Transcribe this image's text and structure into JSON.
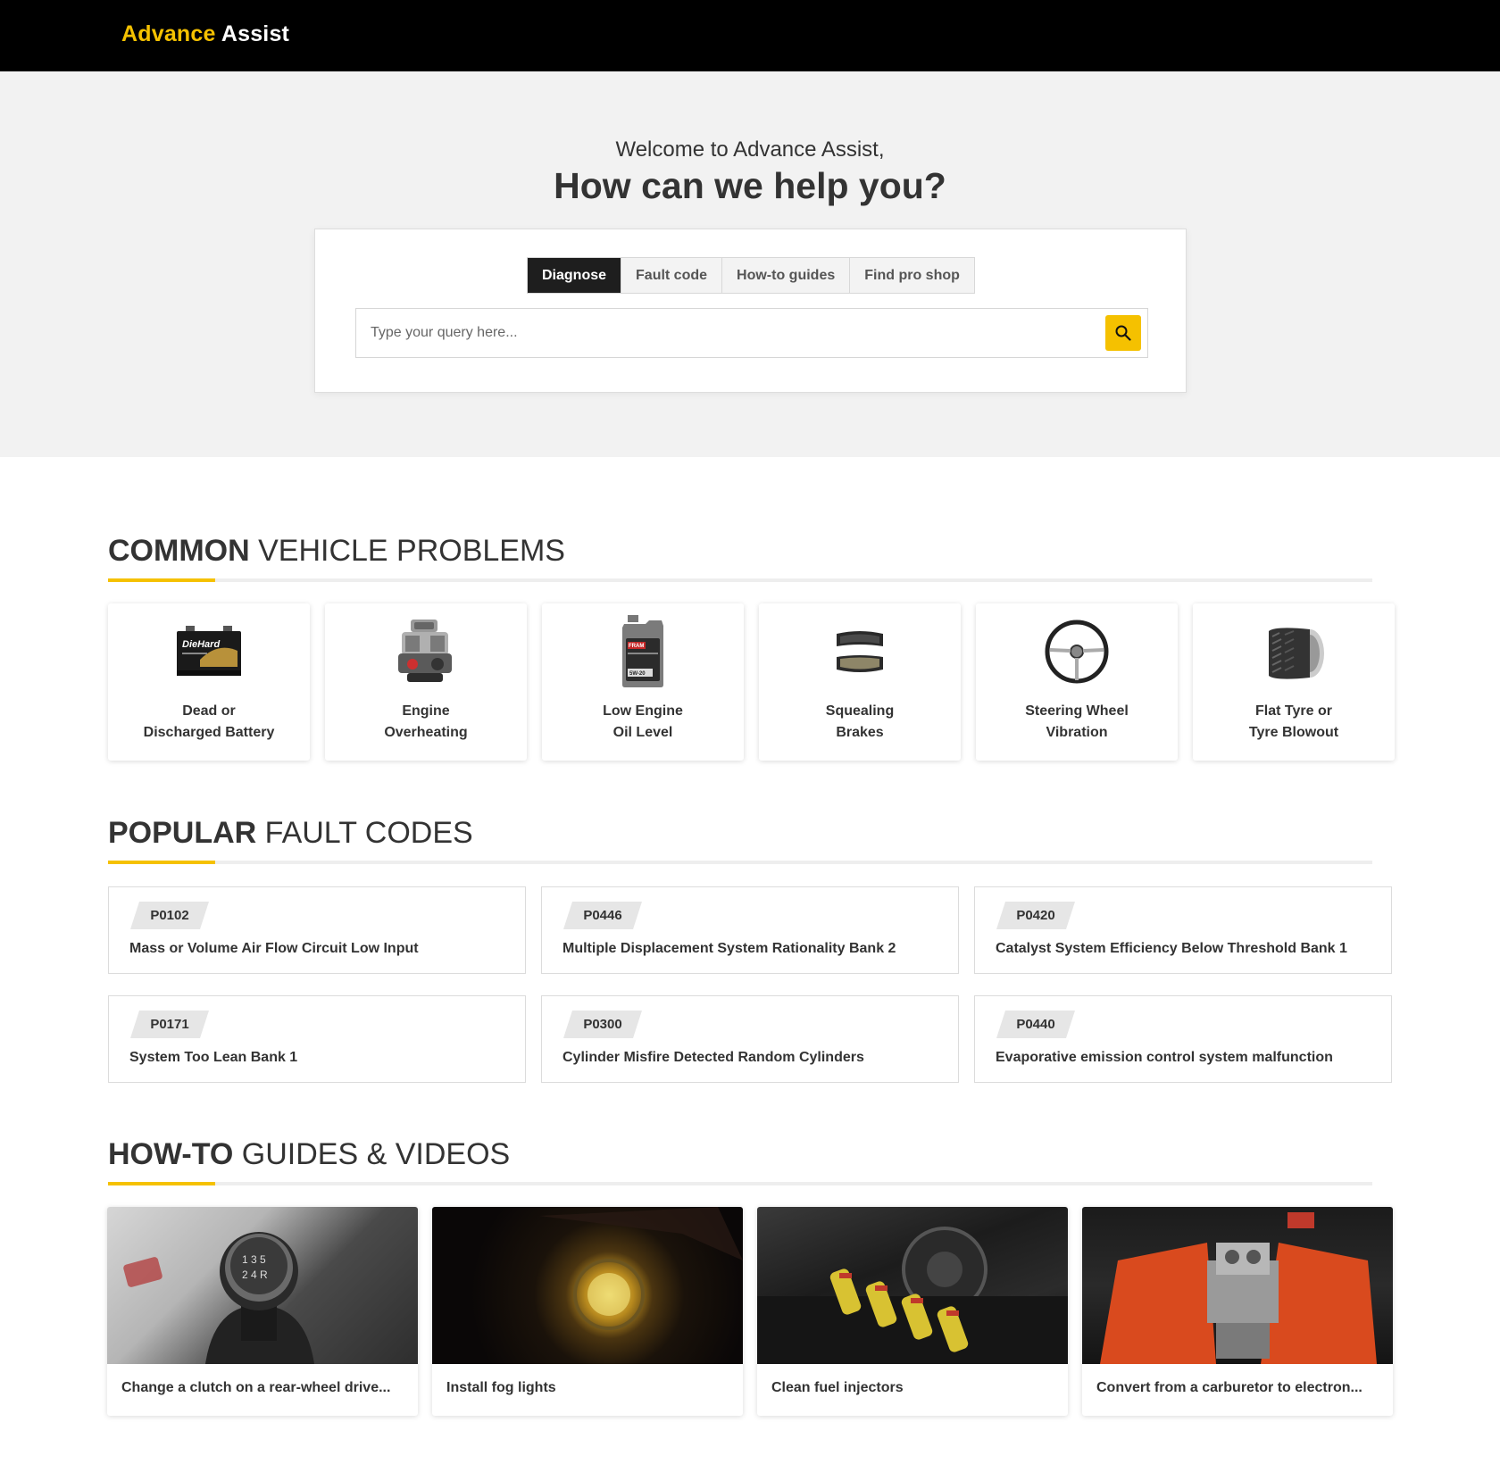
{
  "header": {
    "logo_part1": "Advance",
    "logo_part2": "Assist"
  },
  "hero": {
    "welcome": "Welcome to Advance Assist,",
    "headline": "How can we help you?",
    "tabs": [
      "Diagnose",
      "Fault code",
      "How-to guides",
      "Find pro shop"
    ],
    "active_tab": "Diagnose",
    "search_placeholder": "Type your query here...",
    "search_value": ""
  },
  "problems": {
    "title_bold": "COMMON",
    "title_light": " VEHICLE PROBLEMS",
    "items": [
      {
        "label": "Dead or\nDischarged Battery",
        "icon": "battery-icon"
      },
      {
        "label": "Engine\nOverheating",
        "icon": "engine-icon"
      },
      {
        "label": "Low Engine\nOil Level",
        "icon": "oil-jug-icon"
      },
      {
        "label": "Squealing\nBrakes",
        "icon": "brake-pads-icon"
      },
      {
        "label": "Steering Wheel\nVibration",
        "icon": "steering-wheel-icon"
      },
      {
        "label": "Flat Tyre or\nTyre Blowout",
        "icon": "tyre-icon"
      }
    ]
  },
  "fault_codes": {
    "title_bold": "POPULAR",
    "title_light": " FAULT CODES",
    "items": [
      {
        "code": "P0102",
        "desc": "Mass or Volume Air Flow Circuit Low Input"
      },
      {
        "code": "P0446",
        "desc": "Multiple Displacement System Rationality Bank 2"
      },
      {
        "code": "P0420",
        "desc": "Catalyst System Efficiency Below Threshold Bank 1"
      },
      {
        "code": "P0171",
        "desc": "System Too Lean Bank 1"
      },
      {
        "code": "P0300",
        "desc": "Cylinder Misfire Detected Random Cylinders"
      },
      {
        "code": "P0440",
        "desc": "Evaporative emission control system malfunction"
      }
    ]
  },
  "guides": {
    "title_bold": "HOW-TO",
    "title_light": " GUIDES & VIDEOS",
    "items": [
      {
        "caption": "Change a clutch on a rear-wheel drive...",
        "image": "gear-shifter-photo"
      },
      {
        "caption": "Install fog lights",
        "image": "fog-light-photo"
      },
      {
        "caption": "Clean fuel injectors",
        "image": "fuel-injectors-photo"
      },
      {
        "caption": "Convert from a carburetor to electron...",
        "image": "carburetor-engine-photo"
      }
    ]
  },
  "colors": {
    "accent": "#f5c100",
    "topbar": "#000000",
    "hero_bg": "#f2f2f2",
    "text": "#333333"
  }
}
